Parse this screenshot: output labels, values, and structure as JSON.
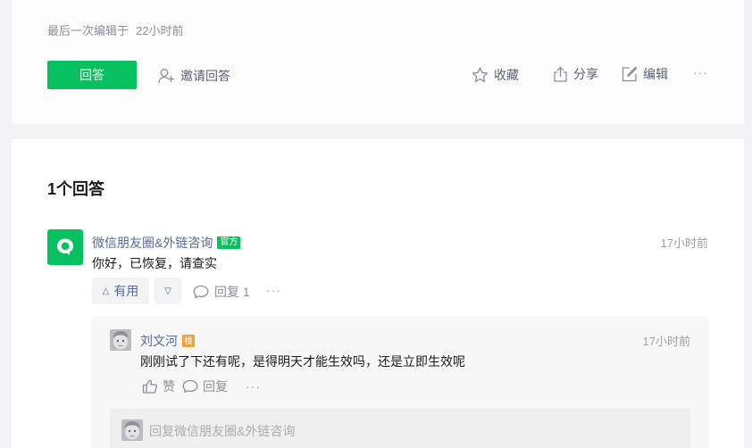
{
  "question": {
    "edited_label": "最后一次编辑于",
    "edited_time": "22小时前",
    "answer_button": "回答",
    "invite_label": "邀请回答",
    "favorite_label": "收藏",
    "share_label": "分享",
    "edit_label": "编辑",
    "more": "···"
  },
  "answers": {
    "title": "1个回答",
    "items": [
      {
        "author": "微信朋友圈&外链咨询",
        "badge": "官方",
        "time": "17小时前",
        "text": "你好，已恢复，请查实",
        "useful_label": "有用",
        "useful_icon": "△",
        "useless_icon": "▽",
        "reply_label": "回复 1",
        "more": "···",
        "replies": [
          {
            "author": "刘文河",
            "badge": "楼",
            "time": "17小时前",
            "text": "刚刚试了下还有呢，是得明天才能生效吗，还是立即生效呢",
            "like_label": "赞",
            "reply_label": "回复",
            "more": "···"
          }
        ],
        "reply_input_placeholder": "回复微信朋友圈&外链咨询"
      }
    ]
  },
  "colors": {
    "accent": "#07c160",
    "link": "#576b95",
    "floor_badge": "#f0a23b"
  }
}
